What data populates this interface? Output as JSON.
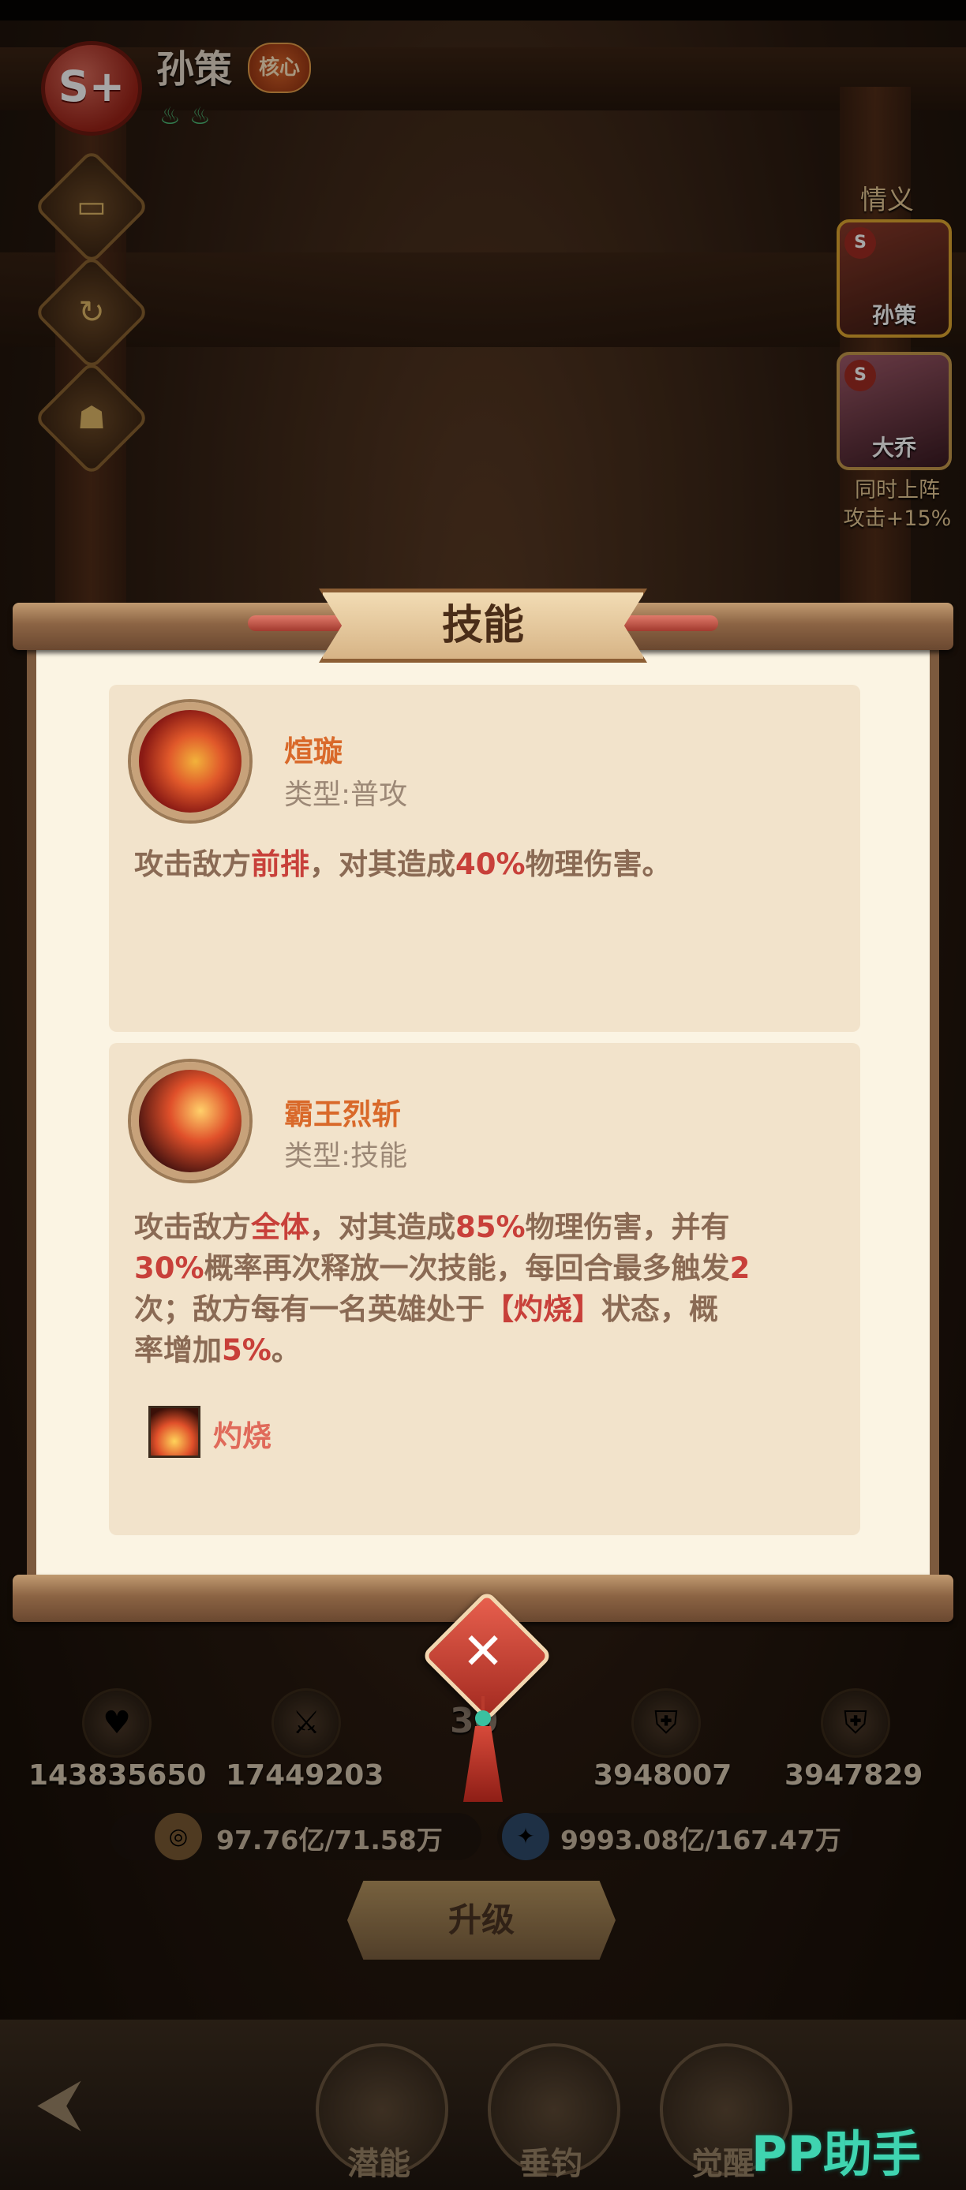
{
  "hero": {
    "rank": "S+",
    "name": "孙策",
    "tag": "核心"
  },
  "side_buttons": [
    "card-icon",
    "refresh-icon",
    "helmet-icon"
  ],
  "bond": {
    "title": "情义",
    "heroes": [
      "孙策",
      "大乔"
    ],
    "bonus_line1": "同时上阵",
    "bonus_line2": "攻击+15%"
  },
  "dialog": {
    "title": "技能",
    "skills": [
      {
        "name": "煊璇",
        "type": "类型:普攻",
        "desc_parts": [
          "攻击敌方",
          "前排",
          "，对其造成",
          "40%",
          "物理伤害。"
        ]
      },
      {
        "name": "霸王烈斩",
        "type": "类型:技能",
        "desc_lines": [
          [
            "攻击敌方",
            "全体",
            "，对其造成",
            "85%",
            "物理伤害，并有"
          ],
          [
            "30%",
            "概率再次释放一次技能，每回合最多触发",
            "2"
          ],
          [
            "次；敌方每有一名英雄处于",
            "【灼烧】",
            "状态，概"
          ],
          [
            "率增加",
            "5%",
            "。"
          ]
        ],
        "status_name": "灼烧"
      }
    ]
  },
  "stats": {
    "hp": "143835650",
    "attack": "17449203",
    "def1": "3948007",
    "def2": "3947829",
    "center_partial": "30"
  },
  "currency": {
    "gold": "97.76亿/71.58万",
    "exp": "9993.08亿/167.47万"
  },
  "upgrade_label": "升级",
  "nav": {
    "potential": "潜能",
    "fishing": "垂钓",
    "awaken": "觉醒"
  },
  "watermark": "PP助手",
  "colors": {
    "highlight": "#c8403a",
    "skill_name": "#d9692a",
    "paper": "#fbf4e3"
  }
}
